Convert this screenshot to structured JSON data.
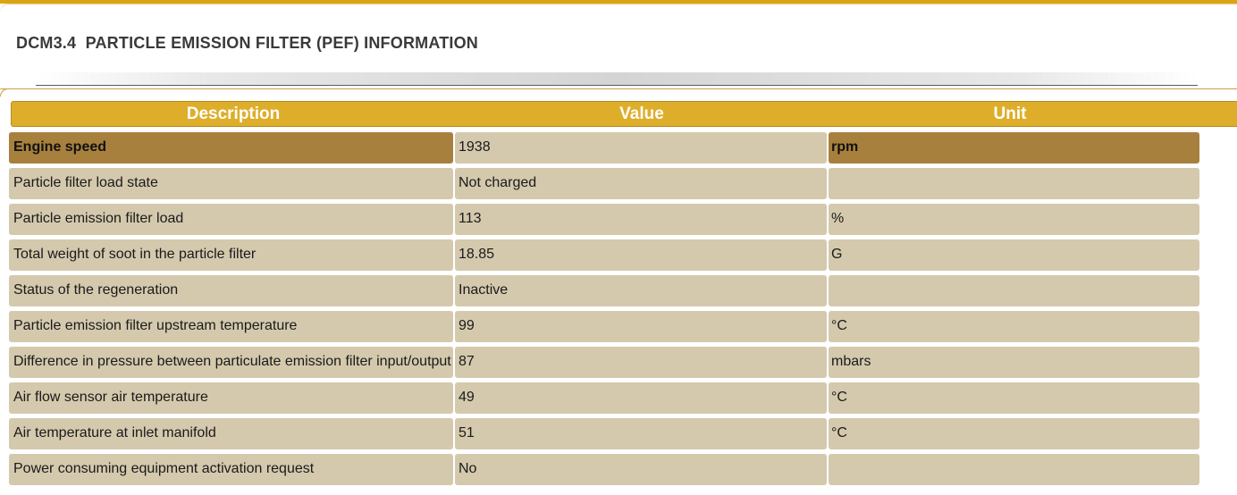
{
  "page": {
    "title": "DCM3.4  PARTICLE EMISSION FILTER (PEF) INFORMATION"
  },
  "colors": {
    "accent_gold": "#deae2b",
    "row_bg": "#d4c9ad",
    "highlight_bg": "#a8803e"
  },
  "table": {
    "headers": {
      "description": "Description",
      "value": "Value",
      "unit": "Unit"
    },
    "rows": [
      {
        "description": "Engine speed",
        "value": "1938",
        "unit": "rpm",
        "highlighted": true
      },
      {
        "description": "Particle filter load state",
        "value": "Not charged",
        "unit": ""
      },
      {
        "description": "Particle emission filter load",
        "value": "113",
        "unit": "%"
      },
      {
        "description": "Total weight of soot in the particle filter",
        "value": "18.85",
        "unit": "G"
      },
      {
        "description": "Status of the regeneration",
        "value": "Inactive",
        "unit": ""
      },
      {
        "description": "Particle emission filter upstream temperature",
        "value": "99",
        "unit": "°C"
      },
      {
        "description": "Difference in pressure between particulate emission filter input/output",
        "value": "87",
        "unit": "mbars"
      },
      {
        "description": "Air flow sensor air temperature",
        "value": "49",
        "unit": "°C"
      },
      {
        "description": "Air temperature at inlet manifold",
        "value": "51",
        "unit": "°C"
      },
      {
        "description": "Power consuming equipment activation request",
        "value": "No",
        "unit": ""
      }
    ]
  }
}
